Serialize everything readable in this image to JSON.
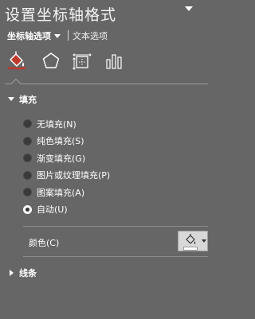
{
  "pane": {
    "title": "设置坐标轴格式",
    "subtabs": {
      "active": "坐标轴选项",
      "other": "文本选项"
    },
    "icon_tabs": [
      "fill-line-icon",
      "effects-pentagon-icon",
      "size-properties-icon",
      "axis-options-bar-chart-icon"
    ]
  },
  "fill_section": {
    "header": "填充",
    "options": [
      {
        "label": "无填充(N)",
        "checked": false
      },
      {
        "label": "纯色填充(S)",
        "checked": false
      },
      {
        "label": "渐变填充(G)",
        "checked": false
      },
      {
        "label": "图片或纹理填充(P)",
        "checked": false
      },
      {
        "label": "图案填充(A)",
        "checked": false
      },
      {
        "label": "自动(U)",
        "checked": true
      }
    ],
    "color_label": "颜色(C)",
    "color_button_icon": "paint-bucket-icon",
    "color_swatch": "#ffffff"
  },
  "line_section": {
    "header": "线条"
  },
  "colors": {
    "background": "#666666",
    "accent_fill_icon": "#c0392b"
  }
}
